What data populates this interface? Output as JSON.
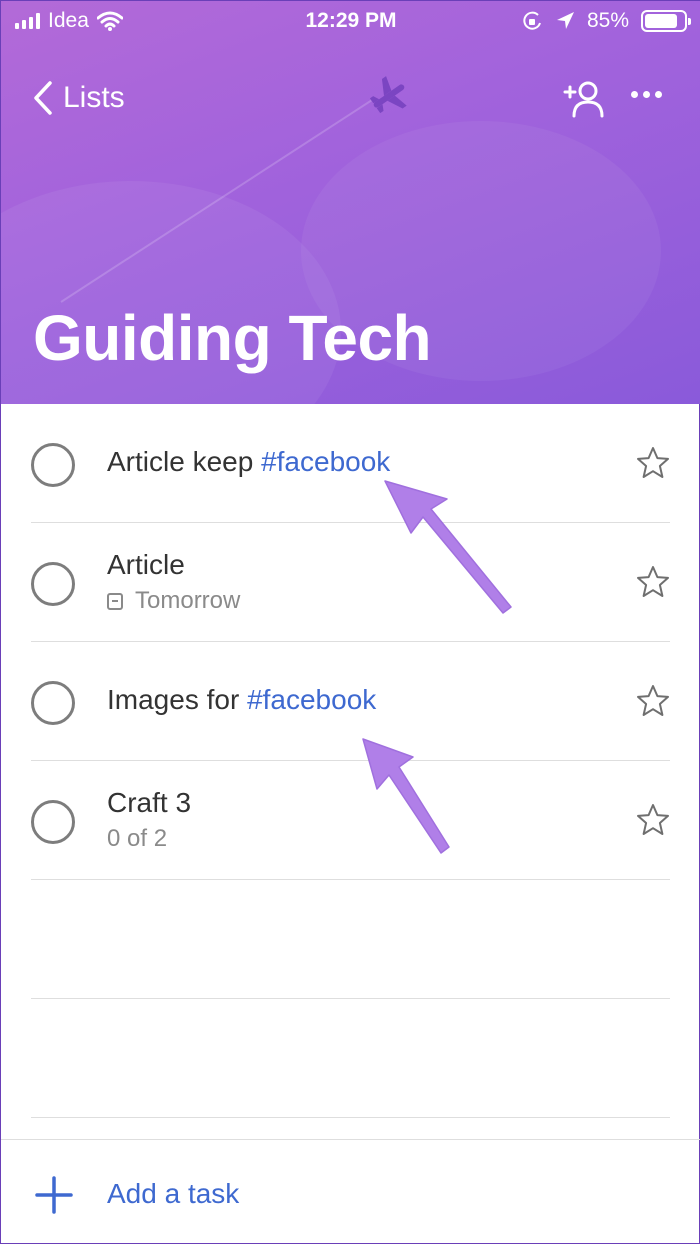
{
  "status_bar": {
    "carrier": "Idea",
    "time": "12:29 PM",
    "battery": "85%",
    "battery_level": 0.85
  },
  "header": {
    "back_label": "Lists",
    "list_title": "Guiding Tech",
    "theme_color": "#a263dc",
    "icons": [
      "chevron-left-icon",
      "airplane-icon",
      "add-person-icon",
      "more-icon"
    ]
  },
  "tasks": [
    {
      "prefix": "Article keep ",
      "hashtag": "#facebook",
      "subtitle": "",
      "completed": false,
      "starred": false
    },
    {
      "prefix": "Article",
      "hashtag": "",
      "subtitle": "Tomorrow",
      "subtitle_icon": "calendar-icon",
      "completed": false,
      "starred": false
    },
    {
      "prefix": "Images for ",
      "hashtag": "#facebook",
      "subtitle": "",
      "completed": false,
      "starred": false
    },
    {
      "prefix": "Craft 3",
      "hashtag": "",
      "subtitle": "0 of 2",
      "completed": false,
      "starred": false
    }
  ],
  "footer": {
    "add_task_label": "Add a task",
    "accent_color": "#3e69d0"
  },
  "annotations": {
    "arrow_color": "#b07fe8"
  }
}
